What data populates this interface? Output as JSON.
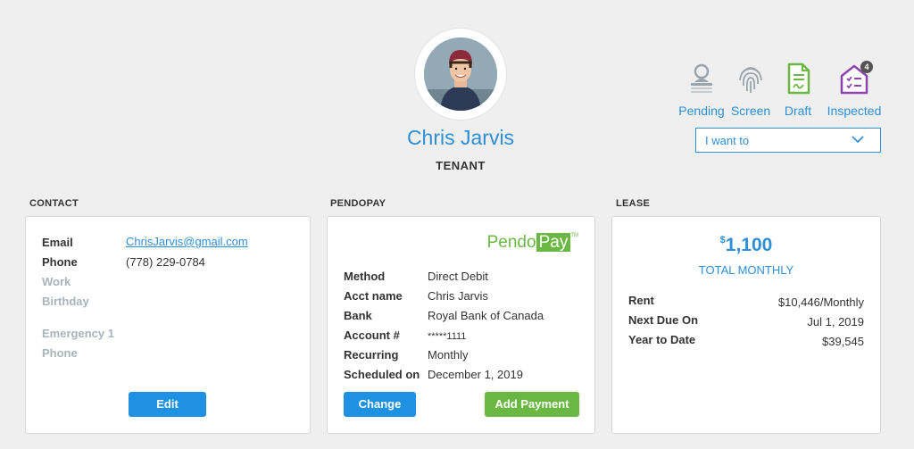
{
  "profile": {
    "name": "Chris Jarvis",
    "role": "TENANT"
  },
  "status_steps": [
    {
      "label": "Pending",
      "icon": "id-card-icon",
      "color": "#9aa4ad"
    },
    {
      "label": "Screen",
      "icon": "fingerprint-icon",
      "color": "#9aa4ad"
    },
    {
      "label": "Draft",
      "icon": "signed-document-icon",
      "color": "#6ab843"
    },
    {
      "label": "Inspected",
      "icon": "house-checklist-icon",
      "color": "#8e44ad",
      "badge": "4"
    }
  ],
  "action_dropdown": {
    "selected": "I want to"
  },
  "contact": {
    "section_title": "CONTACT",
    "email_label": "Email",
    "email_value": "ChrisJarvis@gmail.com",
    "phone_label": "Phone",
    "phone_value": "(778) 229-0784",
    "work_label": "Work",
    "birthday_label": "Birthday",
    "emergency_label": "Emergency 1",
    "emergency_phone_label": "Phone",
    "edit_button": "Edit"
  },
  "pendopay": {
    "section_title": "PENDOPAY",
    "logo_text_1": "Pendo",
    "logo_text_2": "Pay",
    "logo_tm": "TM",
    "method_label": "Method",
    "method_value": "Direct Debit",
    "acct_name_label": "Acct name",
    "acct_name_value": "Chris Jarvis",
    "bank_label": "Bank",
    "bank_value": "Royal Bank of Canada",
    "account_label": "Account #",
    "account_value": "*****1111",
    "recurring_label": "Recurring",
    "recurring_value": "Monthly",
    "scheduled_label": "Scheduled on",
    "scheduled_value": "December 1, 2019",
    "change_button": "Change",
    "add_payment_button": "Add Payment"
  },
  "lease": {
    "section_title": "LEASE",
    "currency": "$",
    "total_amount": "1,100",
    "total_caption": "TOTAL MONTHLY",
    "rent_label": "Rent",
    "rent_value": "$10,446/Monthly",
    "next_due_label": "Next Due On",
    "next_due_value": "Jul 1, 2019",
    "ytd_label": "Year to Date",
    "ytd_value": "$39,545"
  },
  "colors": {
    "accent": "#2e8fd6",
    "green": "#6ab843",
    "button_blue": "#1e91e3",
    "purple": "#8e44ad"
  }
}
